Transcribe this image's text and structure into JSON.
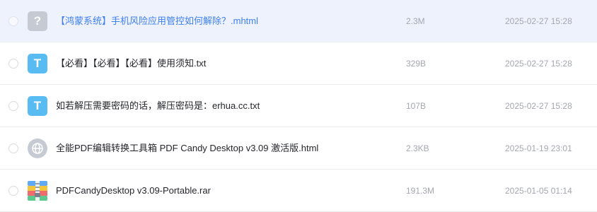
{
  "files": [
    {
      "name": "【鸿蒙系统】手机风险应用管控如何解除？.mhtml",
      "size": "2.3M",
      "date": "2025-02-27 15:28",
      "icon": "unknown-file-icon",
      "icon_glyph": "?",
      "highlighted": true
    },
    {
      "name": "【必看】【必看】【必看】使用须知.txt",
      "size": "329B",
      "date": "2025-02-27 15:28",
      "icon": "text-file-icon",
      "icon_glyph": "T",
      "highlighted": false
    },
    {
      "name": "如若解压需要密码的话，解压密码是：erhua.cc.txt",
      "size": "107B",
      "date": "2025-02-27 15:28",
      "icon": "text-file-icon",
      "icon_glyph": "T",
      "highlighted": false
    },
    {
      "name": "全能PDF编辑转换工具箱 PDF Candy Desktop v3.09 激活版.html",
      "size": "2.3KB",
      "date": "2025-01-19 23:01",
      "icon": "globe-icon",
      "highlighted": false
    },
    {
      "name": "PDFCandyDesktop v3.09-Portable.rar",
      "size": "191.3M",
      "date": "2025-01-05 01:14",
      "icon": "archive-file-icon",
      "highlighted": false
    }
  ],
  "colors": {
    "highlight_bg": "#eef2fc",
    "highlight_text": "#3f7ff0",
    "txt_icon": "#58bcf2",
    "unknown_icon": "#c6cad3",
    "meta_text": "#a4a7ae"
  }
}
